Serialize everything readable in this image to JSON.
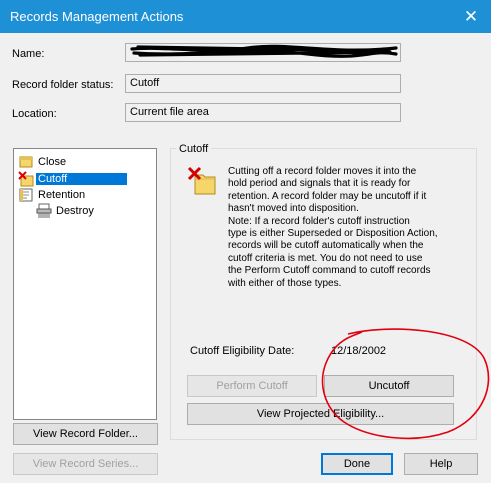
{
  "window": {
    "title": "Records Management Actions",
    "close_glyph": "✕"
  },
  "fields": {
    "name_label": "Name:",
    "name_value": "",
    "status_label": "Record folder status:",
    "status_value": "Cutoff",
    "location_label": "Location:",
    "location_value": "Current file area"
  },
  "tree": {
    "items": [
      {
        "label": "Close",
        "icon": "close-action-icon"
      },
      {
        "label": "Cutoff",
        "icon": "cutoff-icon",
        "selected": true
      },
      {
        "label": "Retention",
        "icon": "retention-icon"
      },
      {
        "label": "Destroy",
        "icon": "shredder-icon"
      }
    ]
  },
  "cutoff_panel": {
    "title": "Cutoff",
    "description": "Cutting off a record folder moves it into the\nhold period and signals that it is ready for\nretention. A record folder may be uncutoff if it\nhasn't moved into disposition.\nNote: If a record folder's cutoff instruction\ntype is either Superseded or Disposition Action,\nrecords will be cutoff automatically when the\ncutoff criteria is met.  You do not need to use\nthe Perform Cutoff command to cutoff records\nwith either of those types.",
    "eligibility_label": "Cutoff Eligibility Date:",
    "eligibility_date": "12/18/2002",
    "perform_cutoff": "Perform Cutoff",
    "uncutoff": "Uncutoff",
    "view_projected": "View Projected Eligibility..."
  },
  "buttons": {
    "view_record_folder": "View Record Folder...",
    "view_record_series": "View Record Series...",
    "done": "Done",
    "help": "Help"
  },
  "colors": {
    "titlebar": "#1e90d6",
    "selection": "#0078d7",
    "annotation": "#e0000f"
  }
}
